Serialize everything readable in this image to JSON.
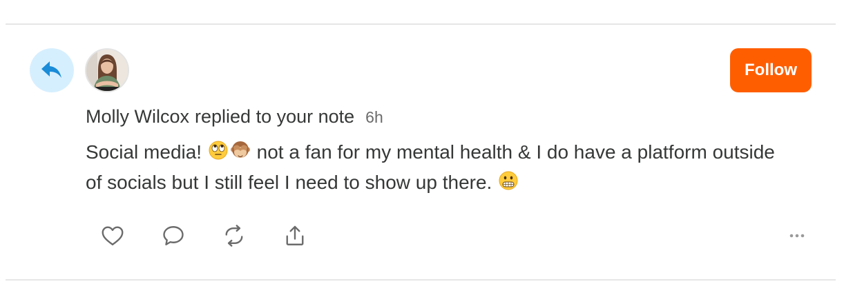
{
  "note": {
    "author_name": "Molly Wilcox",
    "action_text": "replied to your note",
    "timestamp": "6h",
    "body_part1": "Social media!",
    "body_part2": "not a fan for my mental health & I do have a platform outside of socials but I still feel I need to show up there."
  },
  "follow_label": "Follow",
  "colors": {
    "follow_bg": "#ff5e00",
    "reply_badge_bg": "#d6efff",
    "reply_icon": "#1a8cd8",
    "text": "#363737",
    "icon_gray": "#6b6b6b",
    "divider": "#e6e6e6"
  },
  "icons": {
    "reply_badge": "reply-arrow-icon",
    "emoji_1": "face-with-rolling-eyes-emoji",
    "emoji_2": "see-no-evil-monkey-emoji",
    "emoji_3": "grimacing-face-emoji",
    "actions": [
      "heart-icon",
      "comment-icon",
      "restack-icon",
      "share-icon",
      "more-icon"
    ]
  }
}
